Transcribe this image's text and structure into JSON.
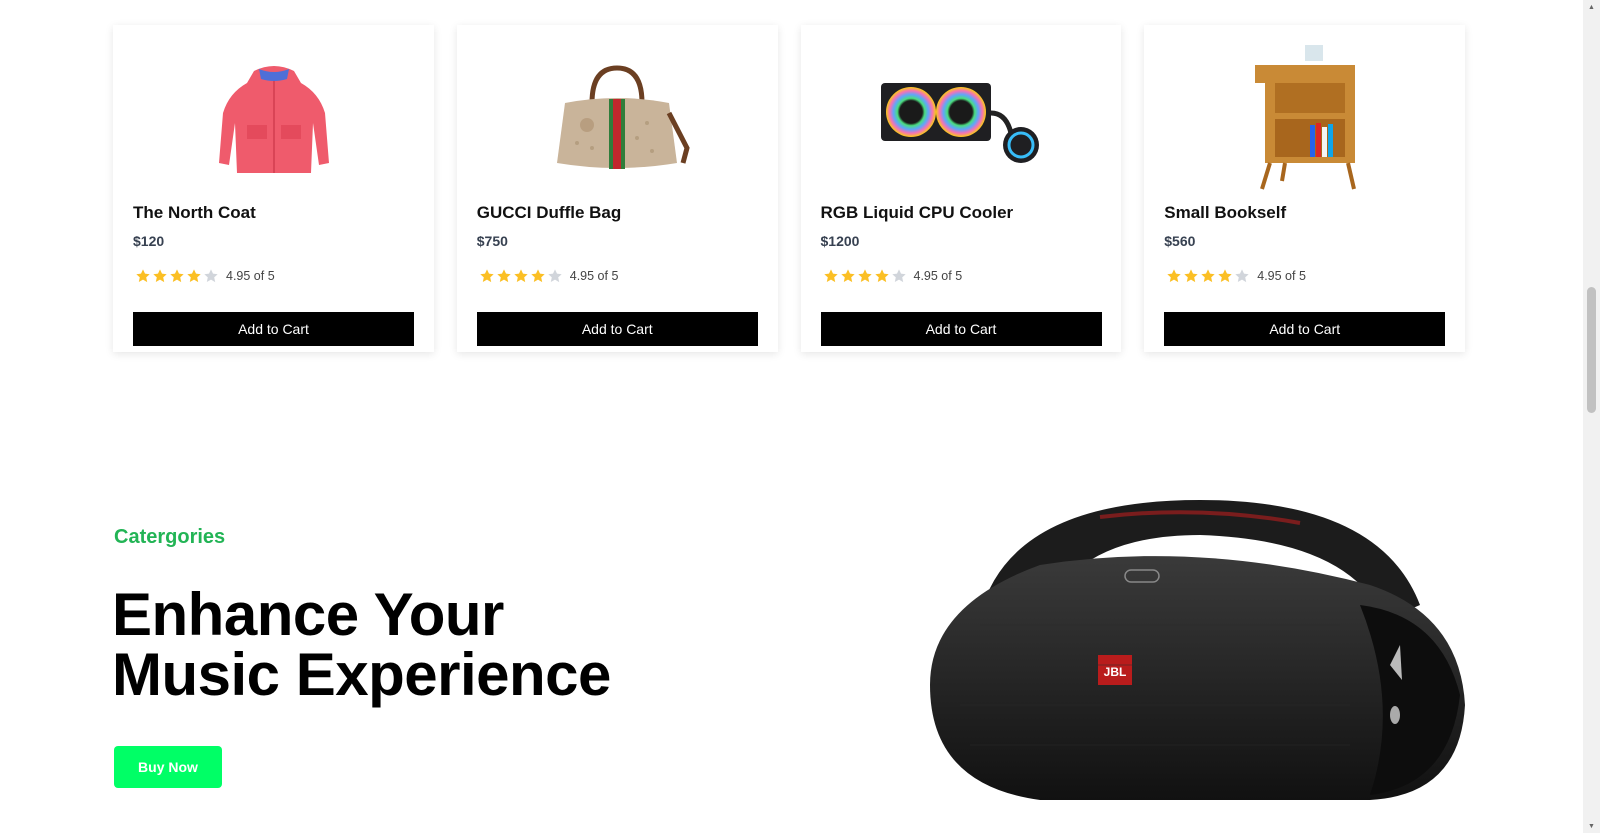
{
  "products": [
    {
      "name": "The North Coat",
      "price": "$120",
      "rating_text": "4.95 of 5",
      "rating": 4,
      "rating_max": 5,
      "button": "Add to Cart",
      "image": "red-coat-image"
    },
    {
      "name": "GUCCI Duffle Bag",
      "price": "$750",
      "rating_text": "4.95 of 5",
      "rating": 4,
      "rating_max": 5,
      "button": "Add to Cart",
      "image": "duffle-bag-image"
    },
    {
      "name": "RGB Liquid CPU Cooler",
      "price": "$1200",
      "rating_text": "4.95 of 5",
      "rating": 4,
      "rating_max": 5,
      "button": "Add to Cart",
      "image": "cpu-cooler-image"
    },
    {
      "name": "Small Bookself",
      "price": "$560",
      "rating_text": "4.95 of 5",
      "rating": 4,
      "rating_max": 5,
      "button": "Add to Cart",
      "image": "bookshelf-image"
    }
  ],
  "banner": {
    "label": "Catergories",
    "headline_line1": "Enhance Your",
    "headline_line2": "Music Experience",
    "button": "Buy Now",
    "image": "jbl-speaker-image",
    "logo_text": "JBL"
  },
  "colors": {
    "accent_green": "#22b455",
    "buy_button": "#00ff66",
    "star_filled": "#fbbf24",
    "star_empty": "#d1d5db",
    "cart_button": "#000000"
  }
}
